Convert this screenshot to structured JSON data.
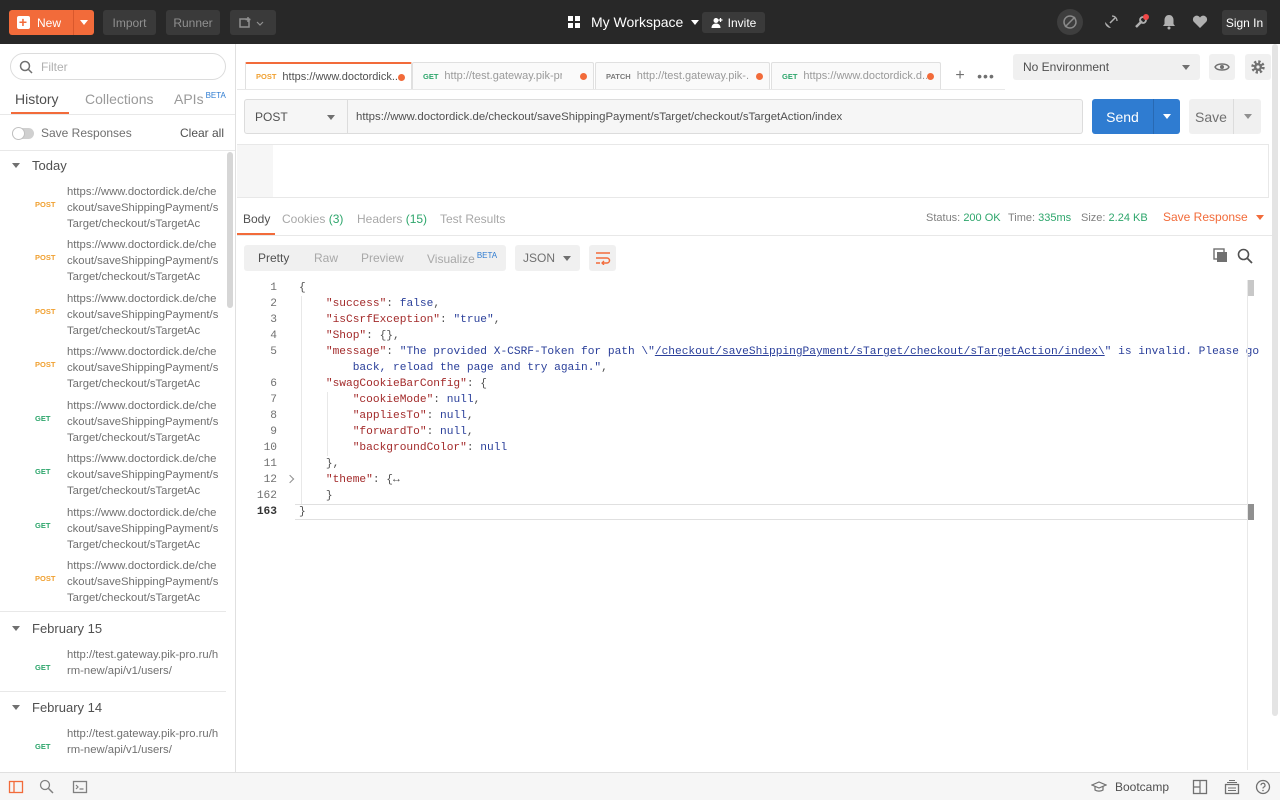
{
  "topbar": {
    "new_label": "New",
    "import_label": "Import",
    "runner_label": "Runner",
    "workspace_label": "My Workspace",
    "invite_label": "Invite",
    "signin_label": "Sign In",
    "accent_color": "#f26b3a"
  },
  "sidebar": {
    "filter_placeholder": "Filter",
    "tabs": [
      {
        "label": "History"
      },
      {
        "label": "Collections"
      },
      {
        "label": "APIs",
        "badge": "BETA"
      }
    ],
    "save_responses_label": "Save Responses",
    "clear_all_label": "Clear all",
    "groups": [
      {
        "title": "Today",
        "items": [
          {
            "method": "POST",
            "url": "https://www.doctordick.de/checkout/saveShippingPayment/sTarget/checkout/sTargetAc"
          },
          {
            "method": "POST",
            "url": "https://www.doctordick.de/checkout/saveShippingPayment/sTarget/checkout/sTargetAc"
          },
          {
            "method": "POST",
            "url": "https://www.doctordick.de/checkout/saveShippingPayment/sTarget/checkout/sTargetAc"
          },
          {
            "method": "POST",
            "url": "https://www.doctordick.de/checkout/saveShippingPayment/sTarget/checkout/sTargetAc"
          },
          {
            "method": "GET",
            "url": "https://www.doctordick.de/checkout/saveShippingPayment/sTarget/checkout/sTargetAc"
          },
          {
            "method": "GET",
            "url": "https://www.doctordick.de/checkout/saveShippingPayment/sTarget/checkout/sTargetAc"
          },
          {
            "method": "GET",
            "url": "https://www.doctordick.de/checkout/saveShippingPayment/sTarget/checkout/sTargetAc"
          },
          {
            "method": "POST",
            "url": "https://www.doctordick.de/checkout/saveShippingPayment/sTarget/checkout/sTargetAc"
          }
        ]
      },
      {
        "title": "February 15",
        "items": [
          {
            "method": "GET",
            "url": "http://test.gateway.pik-pro.ru/hrm-new/api/v1/users/"
          }
        ]
      },
      {
        "title": "February 14",
        "items": [
          {
            "method": "GET",
            "url": "http://test.gateway.pik-pro.ru/hrm-new/api/v1/users/"
          }
        ]
      }
    ]
  },
  "request_tabs": [
    {
      "method": "POST",
      "url": "https://www.doctordick...."
    },
    {
      "method": "GET",
      "url": "http://test.gateway.pik-pr..."
    },
    {
      "method": "PATCH",
      "url": "http://test.gateway.pik-..."
    },
    {
      "method": "GET",
      "url": "https://www.doctordick.d..."
    }
  ],
  "environment": {
    "selected": "No Environment"
  },
  "request": {
    "method": "POST",
    "url": "https://www.doctordick.de/checkout/saveShippingPayment/sTarget/checkout/sTargetAction/index",
    "send_label": "Send",
    "save_label": "Save"
  },
  "response": {
    "tabs": [
      {
        "label": "Body"
      },
      {
        "label": "Cookies",
        "count": "(3)"
      },
      {
        "label": "Headers",
        "count": "(15)"
      },
      {
        "label": "Test Results"
      }
    ],
    "status_label": "Status:",
    "status_value": "200 OK",
    "time_label": "Time:",
    "time_value": "335ms",
    "size_label": "Size:",
    "size_value": "2.24 KB",
    "save_response_label": "Save Response",
    "view_options": [
      "Pretty",
      "Raw",
      "Preview",
      "Visualize"
    ],
    "visualize_badge": "BETA",
    "format": "JSON"
  },
  "code_lines": {
    "l1": "1",
    "l2": "2",
    "l3": "3",
    "l4": "4",
    "l5": "5",
    "l6": "6",
    "l7": "7",
    "l8": "8",
    "l9": "9",
    "l10": "10",
    "l11": "11",
    "l12": "12",
    "l162": "162",
    "l163": "163",
    "t1": "{",
    "t2_key": "\"success\"",
    "t2_val": "false",
    "t3_key": "\"isCsrfException\"",
    "t3_val": "\"true\"",
    "t4_key": "\"Shop\"",
    "t4_val": "{}",
    "t5_key": "\"message\"",
    "t5_val_a": "\"The provided X-CSRF-Token for path \\\"",
    "t5_link": "/checkout/saveShippingPayment/sTarget/checkout/sTargetAction/index\\",
    "t5_val_b": "\" is invalid. Please go",
    "t5_cont": "back, reload the page and try again.\"",
    "t6_key": "\"swagCookieBarConfig\"",
    "t7_key": "\"cookieMode\"",
    "t7_val": "null",
    "t8_key": "\"appliesTo\"",
    "t8_val": "null",
    "t9_key": "\"forwardTo\"",
    "t9_val": "null",
    "t10_key": "\"backgroundColor\"",
    "t10_val": "null",
    "t11": "},",
    "t12_key": "\"theme\"",
    "t12_val": "{↔",
    "t162": "}",
    "t163": "}"
  },
  "bottombar": {
    "bootcamp_label": "Bootcamp"
  }
}
